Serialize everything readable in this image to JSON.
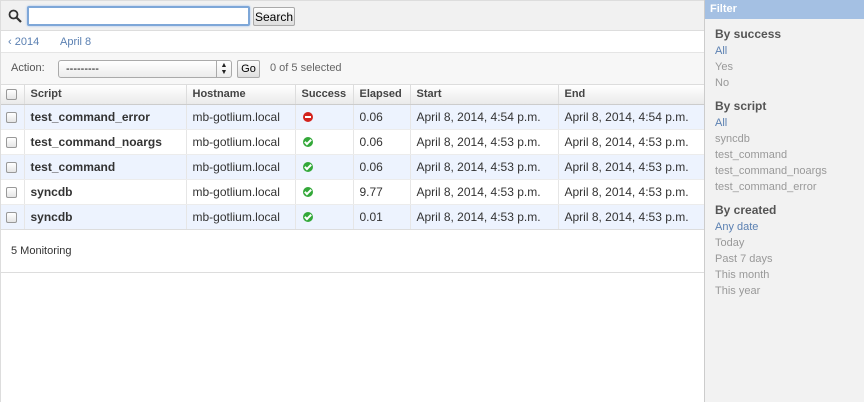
{
  "search": {
    "value": "",
    "button_label": "Search"
  },
  "date_hierarchy": {
    "back": "‹ 2014",
    "current": "April 8"
  },
  "actions": {
    "label": "Action:",
    "select_value": "---------",
    "go_label": "Go",
    "selected_text": "0 of 5 selected"
  },
  "table": {
    "headers": [
      "Script",
      "Hostname",
      "Success",
      "Elapsed",
      "Start",
      "End"
    ],
    "rows": [
      {
        "script": "test_command_error",
        "hostname": "mb-gotlium.local",
        "success": false,
        "elapsed": "0.06",
        "start": "April 8, 2014, 4:54 p.m.",
        "end": "April 8, 2014, 4:54 p.m."
      },
      {
        "script": "test_command_noargs",
        "hostname": "mb-gotlium.local",
        "success": true,
        "elapsed": "0.06",
        "start": "April 8, 2014, 4:53 p.m.",
        "end": "April 8, 2014, 4:53 p.m."
      },
      {
        "script": "test_command",
        "hostname": "mb-gotlium.local",
        "success": true,
        "elapsed": "0.06",
        "start": "April 8, 2014, 4:53 p.m.",
        "end": "April 8, 2014, 4:53 p.m."
      },
      {
        "script": "syncdb",
        "hostname": "mb-gotlium.local",
        "success": true,
        "elapsed": "9.77",
        "start": "April 8, 2014, 4:53 p.m.",
        "end": "April 8, 2014, 4:53 p.m."
      },
      {
        "script": "syncdb",
        "hostname": "mb-gotlium.local",
        "success": true,
        "elapsed": "0.01",
        "start": "April 8, 2014, 4:53 p.m.",
        "end": "April 8, 2014, 4:53 p.m."
      }
    ]
  },
  "paginator": {
    "text": "5 Monitoring"
  },
  "filter": {
    "title": "Filter",
    "groups": [
      {
        "heading": "By success",
        "items": [
          "All",
          "Yes",
          "No"
        ],
        "active": 0
      },
      {
        "heading": "By script",
        "items": [
          "All",
          "syncdb",
          "test_command",
          "test_command_noargs",
          "test_command_error"
        ],
        "active": 0
      },
      {
        "heading": "By created",
        "items": [
          "Any date",
          "Today",
          "Past 7 days",
          "This month",
          "This year"
        ],
        "active": 0
      }
    ]
  },
  "colors": {
    "link": "#5b80b2",
    "filter_header": "#a4c0e3",
    "row_alt": "#edf3fe",
    "success_green": "#33a839",
    "error_red": "#d3231d"
  }
}
